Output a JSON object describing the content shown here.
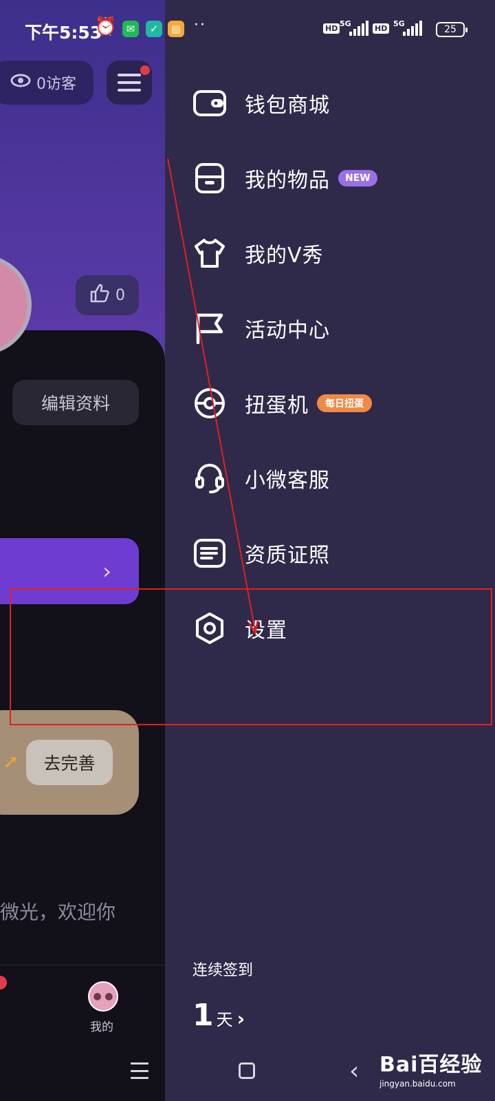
{
  "status_bar": {
    "time": "下午5:53",
    "hd_label": "HD",
    "network_label": "5G",
    "battery": "25"
  },
  "background_page": {
    "visitors_label": "0访客",
    "like_count": "0",
    "edit_profile": "编辑资料",
    "complete_button": "去完善",
    "welcome_text": "微光，欢迎你",
    "nav_me_label": "我的"
  },
  "drawer": {
    "items": [
      {
        "label": "钱包商城",
        "icon": "wallet-icon"
      },
      {
        "label": "我的物品",
        "icon": "box-icon",
        "badge": "NEW"
      },
      {
        "label": "我的V秀",
        "icon": "tshirt-icon"
      },
      {
        "label": "活动中心",
        "icon": "flag-icon"
      },
      {
        "label": "扭蛋机",
        "icon": "gacha-icon",
        "badge": "每日扭蛋"
      },
      {
        "label": "小微客服",
        "icon": "headset-icon"
      },
      {
        "label": "资质证照",
        "icon": "certificate-icon"
      },
      {
        "label": "设置",
        "icon": "settings-icon"
      }
    ],
    "checkin_title": "连续签到",
    "checkin_days": "1",
    "checkin_unit": "天"
  },
  "watermark": {
    "logo": "Bai百经验",
    "url": "jingyan.baidu.com"
  },
  "colors": {
    "drawer_bg": "#2f2a4a",
    "badge_new": "#9a70e8",
    "badge_daily": "#ee8a45",
    "annotation": "#e02020"
  }
}
